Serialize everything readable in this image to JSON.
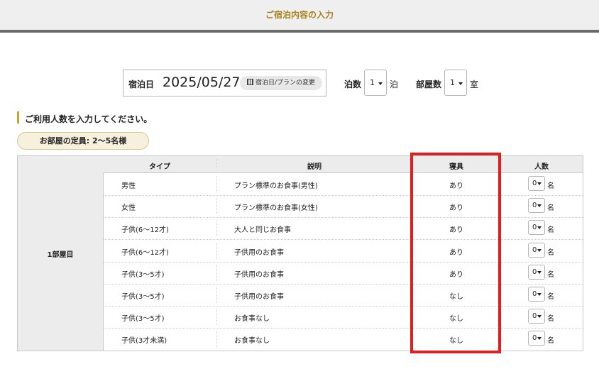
{
  "header": {
    "title": "ご宿泊内容の入力"
  },
  "stay": {
    "date_label": "宿泊日",
    "date_value": "2025/05/27",
    "change_button": "宿泊日/プランの変更",
    "nights_label": "泊数",
    "nights_value": "1",
    "nights_unit": "泊",
    "rooms_label": "部屋数",
    "rooms_value": "1",
    "rooms_unit": "室"
  },
  "section": {
    "title": "ご利用人数を入力してください。",
    "capacity": "お部屋の定員: 2〜5名様"
  },
  "table": {
    "room_label": "1部屋目",
    "headers": {
      "type": "タイプ",
      "desc": "説明",
      "bedding": "寝具",
      "count": "人数"
    },
    "count_unit": "名",
    "rows": [
      {
        "type": "男性",
        "desc": "プラン標準のお食事(男性)",
        "bedding": "あり",
        "count": "0"
      },
      {
        "type": "女性",
        "desc": "プラン標準のお食事(女性)",
        "bedding": "あり",
        "count": "0"
      },
      {
        "type": "子供(6〜12才)",
        "desc": "大人と同じお食事",
        "bedding": "あり",
        "count": "0"
      },
      {
        "type": "子供(6〜12才)",
        "desc": "子供用のお食事",
        "bedding": "あり",
        "count": "0"
      },
      {
        "type": "子供(3〜5才)",
        "desc": "子供用のお食事",
        "bedding": "あり",
        "count": "0"
      },
      {
        "type": "子供(3〜5才)",
        "desc": "子供用のお食事",
        "bedding": "なし",
        "count": "0"
      },
      {
        "type": "子供(3〜5才)",
        "desc": "お食事なし",
        "bedding": "なし",
        "count": "0"
      },
      {
        "type": "子供(3才未満)",
        "desc": "お食事なし",
        "bedding": "なし",
        "count": "0"
      }
    ]
  },
  "icons": {
    "calendar": "calendar-icon",
    "dropdown": "chevron-down-icon"
  },
  "colors": {
    "accent": "#a8821e",
    "highlight": "#e02020",
    "section_bar": "#c9a227"
  }
}
